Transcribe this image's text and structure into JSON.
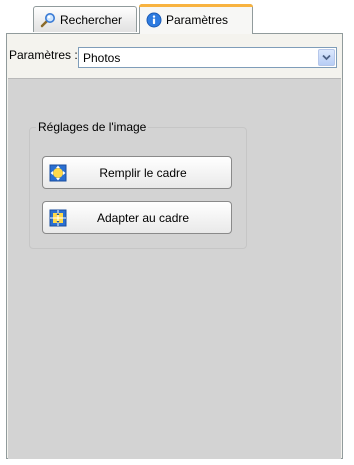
{
  "tabs": [
    {
      "label": "Rechercher",
      "icon": "search-icon",
      "active": false
    },
    {
      "label": "Paramètres",
      "icon": "info-icon",
      "active": true
    }
  ],
  "settings": {
    "label": "Paramètres :",
    "selected": "Photos"
  },
  "image_group": {
    "title": "Réglages de l'image",
    "buttons": [
      {
        "label": "Remplir le cadre",
        "icon": "fill-frame-icon"
      },
      {
        "label": "Adapter au cadre",
        "icon": "fit-frame-icon"
      }
    ]
  },
  "colors": {
    "active_tab_accent": "#f8b340",
    "panel_bg": "#d3d3d3",
    "select_border": "#7f9db9"
  }
}
